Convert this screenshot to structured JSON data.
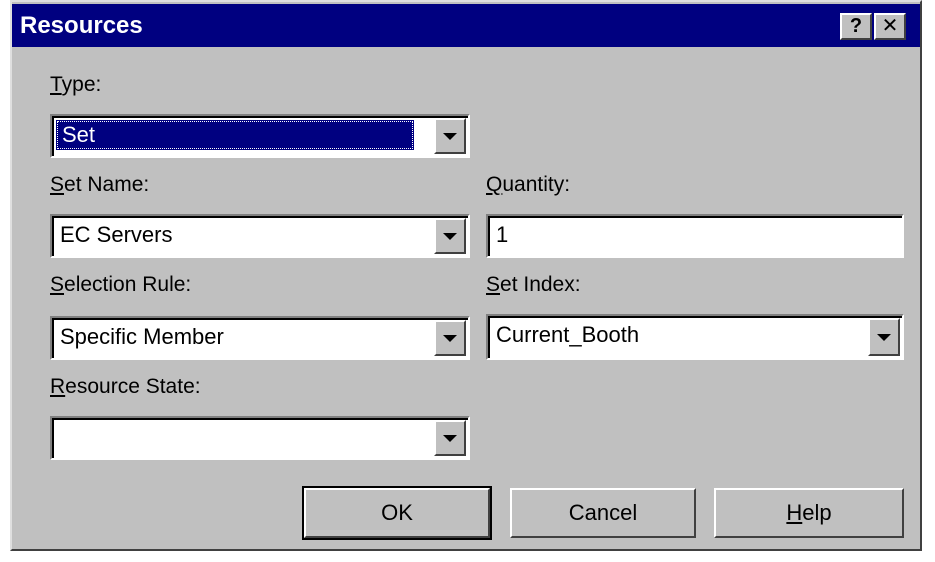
{
  "window": {
    "title": "Resources",
    "help_button": "?",
    "close_button": "✕"
  },
  "form": {
    "type": {
      "label_key": "T",
      "label_rest": "ype:",
      "value": "Set"
    },
    "set_name": {
      "label_key": "S",
      "label_rest": "et Name:",
      "value": "EC Servers"
    },
    "quantity": {
      "label_key": "Q",
      "label_rest": "uantity:",
      "value": "1"
    },
    "selection_rule": {
      "label_key": "S",
      "label_rest": "election Rule:",
      "value": "Specific Member"
    },
    "set_index": {
      "label_key": "S",
      "label_rest": "et Index:",
      "value": "Current_Booth"
    },
    "resource_state": {
      "label_key": "R",
      "label_rest": "esource State:",
      "value": ""
    }
  },
  "buttons": {
    "ok": "OK",
    "cancel": "Cancel",
    "help_key": "H",
    "help_rest": "elp"
  },
  "colors": {
    "titlebar": "#000080",
    "face": "#c0c0c0",
    "selection": "#000080"
  }
}
